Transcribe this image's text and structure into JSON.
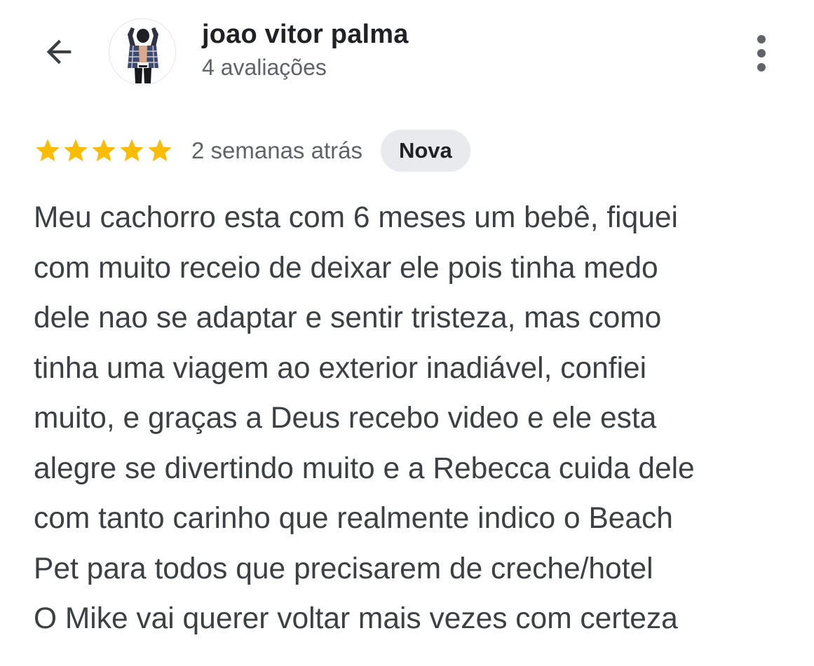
{
  "header": {
    "back_icon": "arrow-back-icon",
    "reviewer_name": "joao vitor palma",
    "review_count": "4 avaliações",
    "avatar_icon": "profile-photo",
    "menu_icon": "more-vert-icon"
  },
  "review": {
    "rating": 5,
    "rating_max": 5,
    "star_color": "#fbbc04",
    "time_ago": "2 semanas atrás",
    "badge": "Nova",
    "lines": [
      "Meu cachorro esta com 6 meses um bebê, fiquei",
      "com muito receio de deixar ele pois tinha medo",
      "dele nao se adaptar e sentir tristeza, mas como",
      "tinha uma viagem ao exterior inadiável, confiei",
      "muito, e graças a Deus recebo video e ele esta",
      "alegre se divertindo muito e a Rebecca cuida dele",
      "com tanto carinho que realmente indico o Beach",
      "Pet para todos que precisarem de creche/hotel",
      "O Mike vai querer voltar mais vezes com certeza"
    ]
  }
}
